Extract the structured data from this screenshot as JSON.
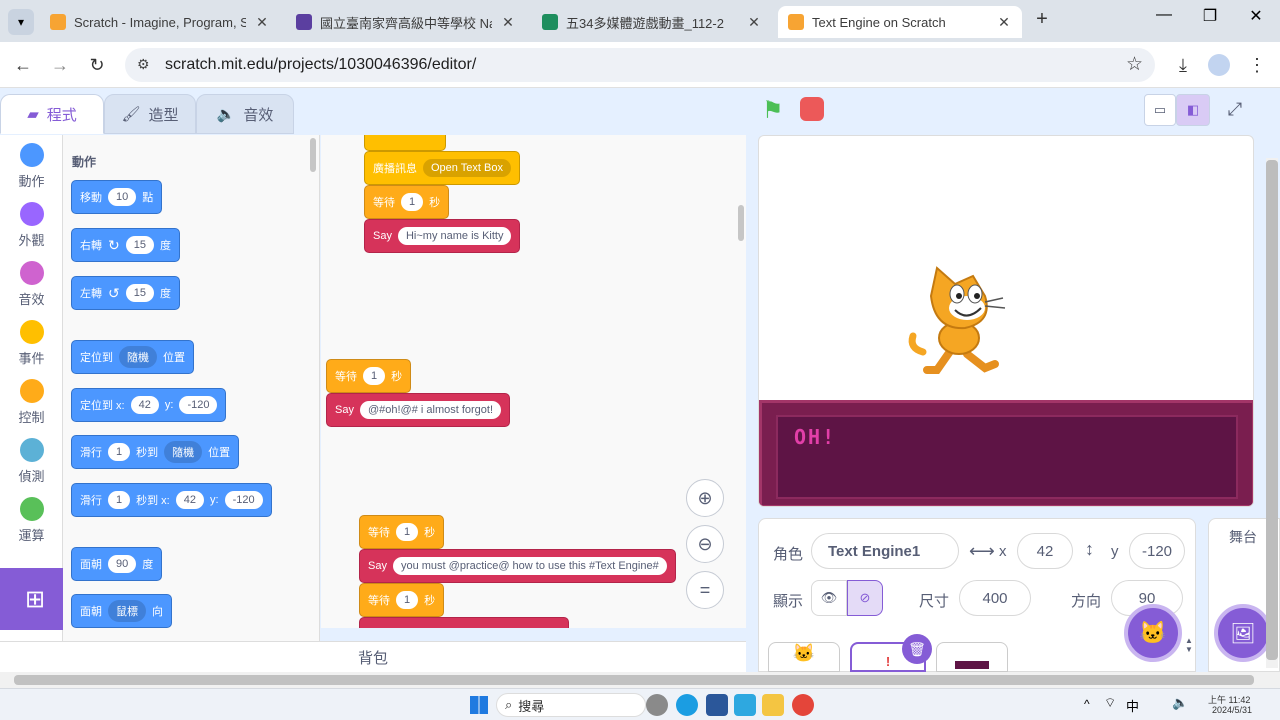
{
  "browser": {
    "tabs": [
      {
        "title": "Scratch - Imagine, Program, S",
        "active": false
      },
      {
        "title": "國立臺南家齊高級中等學校 Nat",
        "active": false
      },
      {
        "title": "五34多媒體遊戲動畫_112-2",
        "active": false
      },
      {
        "title": "Text Engine on Scratch",
        "active": true
      }
    ],
    "new_tab": "+",
    "url": "scratch.mit.edu/projects/1030046396/editor/"
  },
  "editor": {
    "tabs": [
      "程式",
      "造型",
      "音效"
    ],
    "categories": [
      "動作",
      "外觀",
      "音效",
      "事件",
      "控制",
      "偵測",
      "運算"
    ],
    "category_colors": [
      "#4c97ff",
      "#9966ff",
      "#cf63cf",
      "#ffbf00",
      "#ffab19",
      "#5cb1d6",
      "#59c059"
    ],
    "palette_title": "動作",
    "palette": {
      "move": {
        "a": "移動",
        "v": "10",
        "b": "點"
      },
      "turn_right": {
        "a": "右轉",
        "v": "15",
        "b": "度"
      },
      "turn_left": {
        "a": "左轉",
        "v": "15",
        "b": "度"
      },
      "goto": {
        "a": "定位到",
        "d": "隨機",
        "b": "位置"
      },
      "goto_xy": {
        "a": "定位到 x:",
        "x": "42",
        "y_lbl": "y:",
        "y": "-120"
      },
      "glide": {
        "a": "滑行",
        "v": "1",
        "b": "秒到",
        "d": "隨機",
        "c": "位置"
      },
      "glide_xy": {
        "a": "滑行",
        "v": "1",
        "b": "秒到 x:",
        "x": "42",
        "y_lbl": "y:",
        "y": "-120"
      },
      "point_dir": {
        "a": "面朝",
        "v": "90",
        "b": "度"
      },
      "point_to": {
        "a": "面朝",
        "d": "鼠標",
        "b": "向"
      }
    },
    "script": {
      "broadcast": {
        "a": "廣播訊息",
        "d": "Open Text Box"
      },
      "wait1": {
        "a": "等待",
        "v": "1",
        "b": "秒"
      },
      "say1": {
        "a": "Say",
        "v": "Hi~my name is Kitty"
      },
      "wait2": {
        "a": "等待",
        "v": "1",
        "b": "秒"
      },
      "say2": {
        "a": "Say",
        "v": "@#oh!@# i almost forgot!"
      },
      "wait3": {
        "a": "等待",
        "v": "1",
        "b": "秒"
      },
      "say3": {
        "a": "Say",
        "v": "you must @practice@ how to use this #Text Engine#"
      },
      "wait4": {
        "a": "等待",
        "v": "1",
        "b": "秒"
      }
    },
    "backpack": "背包",
    "stage_text": "OH!",
    "sprite": {
      "role_label": "角色",
      "name": "Text Engine1",
      "x_label": "x",
      "x": "42",
      "y_label": "y",
      "y": "-120",
      "show_label": "顯示",
      "size_label": "尺寸",
      "size": "400",
      "dir_label": "方向",
      "direction": "90"
    },
    "stage_tab": "舞台"
  },
  "taskbar": {
    "search": "搜尋",
    "time": "上午 11:42",
    "date": "2024/5/31",
    "ime": "中"
  }
}
